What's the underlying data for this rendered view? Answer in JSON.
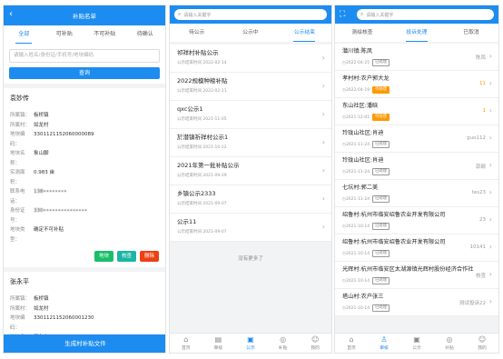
{
  "p1": {
    "title": "补贴名单",
    "tabs": [
      "全部",
      "可补贴",
      "不可补贴",
      "待确认"
    ],
    "search_placeholder": "请输入姓名/身份证/手机号/地块编码",
    "query_label": "查询",
    "card1": {
      "name": "袁妙传",
      "fields": [
        {
          "label": "所属镇：",
          "value": "板桥镇",
          "blur": false
        },
        {
          "label": "所属村：",
          "value": "如龙村",
          "blur": false
        },
        {
          "label": "地块编码：",
          "value": "3301121152060000089",
          "blur": false
        },
        {
          "label": "地块名称：",
          "value": "象山脚",
          "blur": false
        },
        {
          "label": "实测面积：",
          "value": "0.983 亩",
          "blur": false
        },
        {
          "label": "联系电话：",
          "value": "138••••••••",
          "blur": true
        },
        {
          "label": "身份证号：",
          "value": "330•••••••••••••••",
          "blur": true
        },
        {
          "label": "地块类型：",
          "value": "确定不可补贴",
          "blur": false
        }
      ],
      "buttons": [
        "地块",
        "核查",
        "删除"
      ]
    },
    "card2": {
      "name": "张永平",
      "fields": [
        {
          "label": "所属镇：",
          "value": "板桥镇"
        },
        {
          "label": "所属村：",
          "value": "如龙村"
        },
        {
          "label": "地块编码：",
          "value": "3301121152060001230"
        },
        {
          "label": "地块名称：",
          "value": "平台上"
        }
      ]
    },
    "generate_label": "生成村补贴文件"
  },
  "p2": {
    "search_placeholder": "请输入关键字",
    "tabs": [
      "待公示",
      "公示中",
      "公示结束"
    ],
    "items": [
      {
        "title": "祁祥村补贴公示",
        "sub": "公示结束时间 2022-02-14"
      },
      {
        "title": "2022规模种粮补贴",
        "sub": "公示结束时间 2022-02-11"
      },
      {
        "title": "qxc公示1",
        "sub": "公示结束时间 2021-11-05"
      },
      {
        "title": "於潜镇祈祥村公示1",
        "sub": "公示结束时间 2021-10-22"
      },
      {
        "title": "2021年第一批补贴公示",
        "sub": "公示结束时间 2021-09-29"
      },
      {
        "title": "乡镇公示2333",
        "sub": "公示结束时间 2021-09-07"
      },
      {
        "title": "公示11",
        "sub": "公示结束时间 2021-09-07"
      }
    ],
    "no_more": "没有更多了",
    "tabbar": [
      {
        "label": "首页",
        "icon": "⌂"
      },
      {
        "label": "审核",
        "icon": "▤"
      },
      {
        "label": "公示",
        "icon": "▣"
      },
      {
        "label": "补贴",
        "icon": "◎"
      },
      {
        "label": "我的",
        "icon": "☺"
      }
    ]
  },
  "p3": {
    "search_placeholder": "请输入关键字",
    "tabs": [
      "测绘核查",
      "投诉处理",
      "已取消"
    ],
    "items": [
      {
        "title": "潜川镇:陈凤",
        "date": "2022-04-25",
        "badge": "已处理",
        "badge_orange": false,
        "right": "陈凤",
        "right_orange": false
      },
      {
        "title": "孝村村:农户郭大龙",
        "date": "2022-04-19",
        "badge": "待处理",
        "badge_orange": true,
        "right": "11",
        "right_orange": true
      },
      {
        "title": "东山社区:潘晗",
        "date": "2021-12-01",
        "badge": "待处理",
        "badge_orange": true,
        "right": "1",
        "right_orange": true
      },
      {
        "title": "玲珑山社区:肖迪",
        "date": "2021-11-24",
        "badge": "已处理",
        "badge_orange": false,
        "right": "guo112",
        "right_orange": false
      },
      {
        "title": "玲珑山社区:肖迪",
        "date": "2021-11-24",
        "badge": "已处理",
        "badge_orange": false,
        "right": "郭颖",
        "right_orange": false
      },
      {
        "title": "七坑村:郭二美",
        "date": "2021-11-24",
        "badge": "已处理",
        "badge_orange": false,
        "right": "tes23",
        "right_orange": false
      },
      {
        "title": "绍鲁村:杭州市临安绍鲁农业开发有限公司",
        "date": "2021-10-14",
        "badge": "已处理",
        "badge_orange": false,
        "right": "23",
        "right_orange": false
      },
      {
        "title": "绍鲁村:杭州市临安绍鲁农业开发有限公司",
        "date": "2021-10-14",
        "badge": "已处理",
        "badge_orange": false,
        "right": "10141",
        "right_orange": false
      },
      {
        "title": "光辉村:杭州市临安区太湖源镇光辉村股份经济合作社",
        "date": "2021-10-14",
        "badge": "已处理",
        "badge_orange": false,
        "right": "核查",
        "right_orange": false
      },
      {
        "title": "塔山村:农户张三",
        "date": "2021-10-14",
        "badge": "已处理",
        "badge_orange": false,
        "right": "测试投诉22",
        "right_orange": false
      }
    ],
    "tabbar": [
      {
        "label": "首页",
        "icon": "⌂"
      },
      {
        "label": "审核",
        "icon": "♙"
      },
      {
        "label": "公示",
        "icon": "▣"
      },
      {
        "label": "补贴",
        "icon": "◎"
      },
      {
        "label": "我的",
        "icon": "☺"
      }
    ]
  },
  "colors": {
    "primary": "#1d8cf0",
    "green": "#19be6b",
    "teal": "#1cb5a4",
    "red": "#ed4014",
    "orange": "#ff9900"
  }
}
